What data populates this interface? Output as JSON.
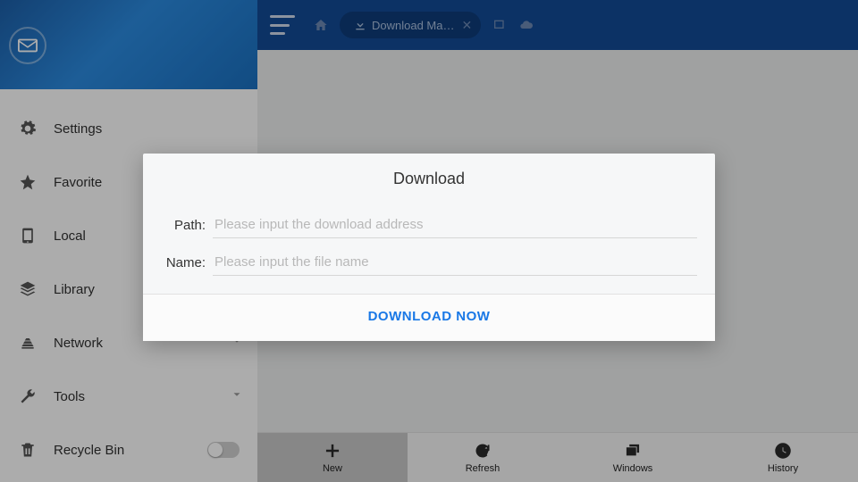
{
  "sidebar": {
    "items": [
      {
        "label": "Settings"
      },
      {
        "label": "Favorite"
      },
      {
        "label": "Local"
      },
      {
        "label": "Library"
      },
      {
        "label": "Network"
      },
      {
        "label": "Tools"
      },
      {
        "label": "Recycle Bin"
      }
    ]
  },
  "topbar": {
    "tab_label": "Download Ma…"
  },
  "bottombar": {
    "items": [
      {
        "label": "New"
      },
      {
        "label": "Refresh"
      },
      {
        "label": "Windows"
      },
      {
        "label": "History"
      }
    ]
  },
  "dialog": {
    "title": "Download",
    "path_label": "Path:",
    "path_placeholder": "Please input the download address",
    "name_label": "Name:",
    "name_placeholder": "Please input the file name",
    "submit_label": "DOWNLOAD NOW"
  },
  "colors": {
    "primary": "#134b96",
    "accent": "#1978e6"
  }
}
